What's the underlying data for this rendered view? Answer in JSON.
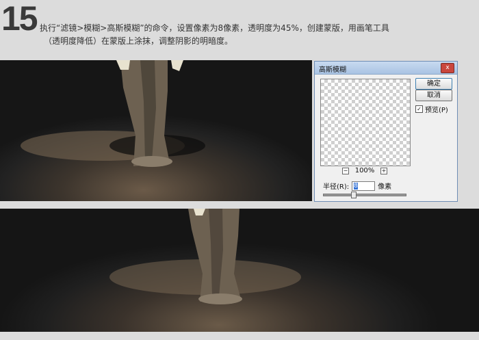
{
  "step_number": "15",
  "instruction": {
    "line1": "执行“滤镜>模糊>高斯模糊”的命令，设置像素为8像素，透明度为45%，创建蒙版，用画笔工具",
    "line2": "（透明度降低）在蒙版上涂抹，调整阴影的明暗度。"
  },
  "dialog": {
    "title": "高斯模糊",
    "close_label": "x",
    "ok_label": "确定",
    "cancel_label": "取消",
    "preview_label": "预览(P)",
    "preview_checked": true,
    "zoom_out_label": "−",
    "zoom_level": "100%",
    "zoom_in_label": "+",
    "radius_label": "半径(R):",
    "radius_value": "8",
    "radius_unit": "像素",
    "radius_slider_fraction": 0.35
  }
}
